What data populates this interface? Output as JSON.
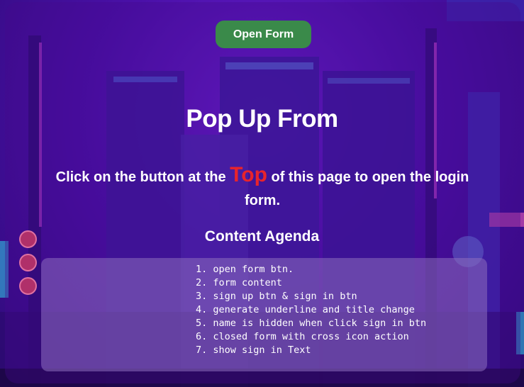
{
  "open_button": {
    "label": "Open Form"
  },
  "heading": {
    "title": "Pop Up From"
  },
  "description": {
    "before": "Click on the button at the ",
    "highlight": "Top",
    "after": " of this page to open the login form."
  },
  "agenda": {
    "title": "Content Agenda",
    "items": [
      "1. open form btn.",
      "2. form content",
      "3. sign up btn & sign in btn",
      "4. generate underline and title change",
      "5. name is hidden when click sign in btn",
      "6. closed form with cross icon action",
      "7. show sign in Text"
    ]
  },
  "colors": {
    "button_bg": "#3a8a4a",
    "highlight": "#e8242c",
    "background": "#4a10a8"
  }
}
